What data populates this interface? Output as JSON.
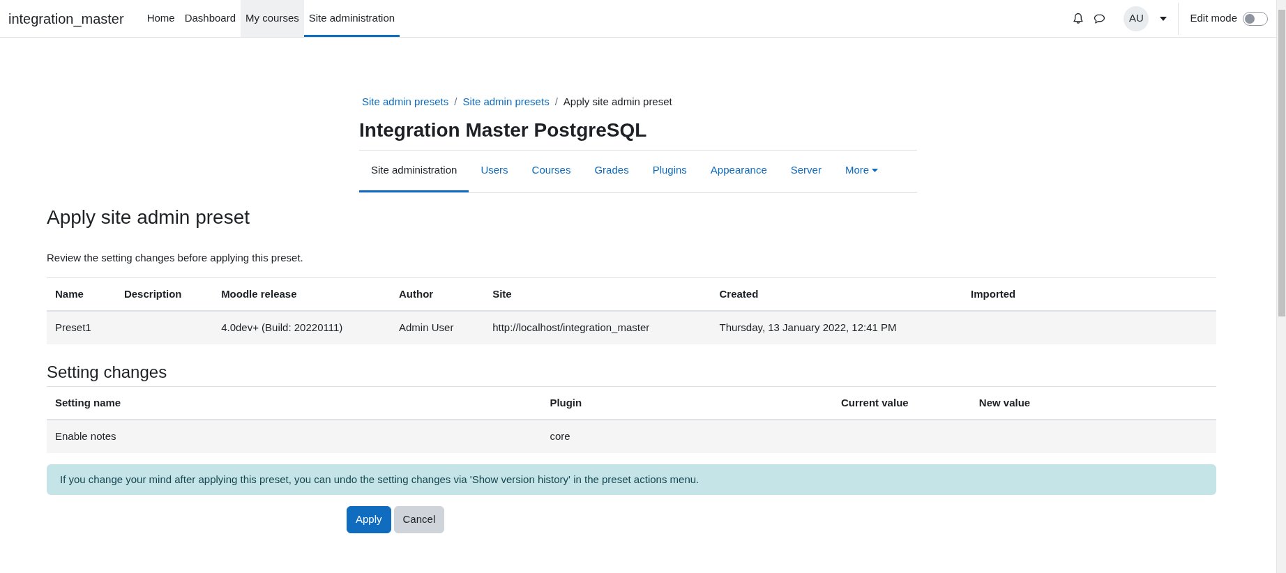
{
  "navbar": {
    "brand": "integration_master",
    "items": [
      {
        "label": "Home",
        "selected": false,
        "highlighted": false
      },
      {
        "label": "Dashboard",
        "selected": false,
        "highlighted": false
      },
      {
        "label": "My courses",
        "selected": false,
        "highlighted": true
      },
      {
        "label": "Site administration",
        "selected": true,
        "highlighted": false
      }
    ],
    "user_initials": "AU",
    "edit_mode": {
      "label": "Edit mode",
      "on": false
    }
  },
  "breadcrumbs": [
    {
      "label": "Site admin presets",
      "link": true
    },
    {
      "separator": "/",
      "label": "Site admin presets",
      "link": true
    },
    {
      "separator": "/",
      "label": "Apply site admin preset",
      "link": false
    }
  ],
  "page_title": "Integration Master PostgreSQL",
  "secondary_nav": [
    {
      "label": "Site administration",
      "selected": true,
      "dropdown": false
    },
    {
      "label": "Users",
      "selected": false,
      "dropdown": false
    },
    {
      "label": "Courses",
      "selected": false,
      "dropdown": false
    },
    {
      "label": "Grades",
      "selected": false,
      "dropdown": false
    },
    {
      "label": "Plugins",
      "selected": false,
      "dropdown": false
    },
    {
      "label": "Appearance",
      "selected": false,
      "dropdown": false
    },
    {
      "label": "Server",
      "selected": false,
      "dropdown": false
    },
    {
      "label": "More",
      "selected": false,
      "dropdown": true
    }
  ],
  "heading": "Apply site admin preset",
  "intro": "Review the setting changes before applying this preset.",
  "preset_table": {
    "columns": [
      "Name",
      "Description",
      "Moodle release",
      "Author",
      "Site",
      "Created",
      "Imported"
    ],
    "rows": [
      [
        "Preset1",
        "",
        "4.0dev+ (Build: 20220111)",
        "Admin User",
        "http://localhost/integration_master",
        "Thursday, 13 January 2022, 12:41 PM",
        ""
      ]
    ]
  },
  "changes_heading": "Setting changes",
  "changes_table": {
    "columns": [
      "Setting name",
      "Plugin",
      "Current value",
      "New value"
    ],
    "rows": [
      [
        "Enable notes",
        "core",
        "",
        ""
      ]
    ]
  },
  "alert": "If you change your mind after applying this preset, you can undo the setting changes via 'Show version history' in the preset actions menu.",
  "buttons": [
    {
      "label": "Apply",
      "kind": "primary"
    },
    {
      "label": "Cancel",
      "kind": "secondary"
    }
  ]
}
